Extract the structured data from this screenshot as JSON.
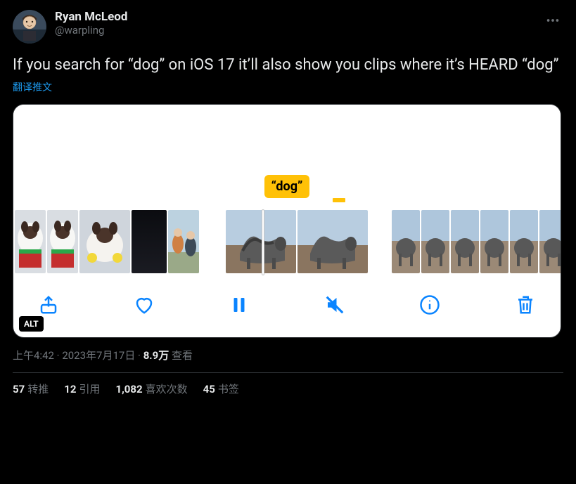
{
  "author": {
    "name": "Ryan McLeod",
    "handle": "@warpling"
  },
  "body": "If you search for “dog” on iOS 17 it’ll also show you clips where it’s HEARD “dog”",
  "translate": "翻译推文",
  "callout": "“dog”",
  "alt_badge": "ALT",
  "meta": {
    "time": "上午4:42",
    "dot1": " · ",
    "date": "2023年7月17日",
    "dot2": " · ",
    "views_num": "8.9万",
    "views_label": " 查看"
  },
  "stats": {
    "retweets_num": "57",
    "retweets_label": "转推",
    "quotes_num": "12",
    "quotes_label": "引用",
    "likes_num": "1,082",
    "likes_label": "喜欢次数",
    "bookmarks_num": "45",
    "bookmarks_label": "书签"
  }
}
